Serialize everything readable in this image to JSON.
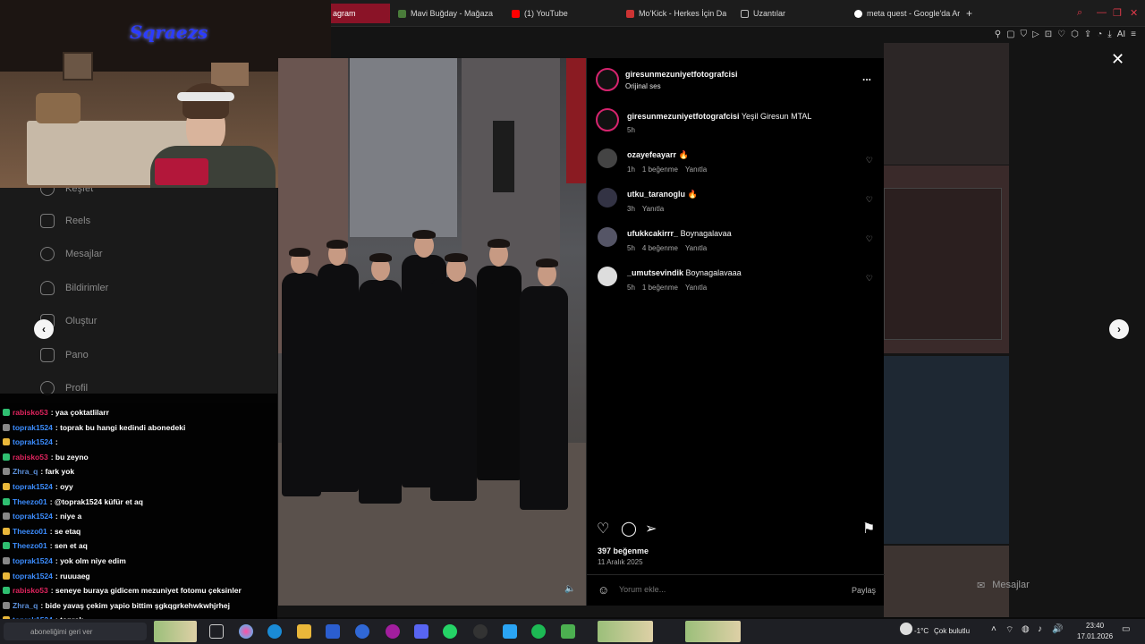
{
  "browser": {
    "tabs": [
      {
        "label": "agram",
        "active": true
      },
      {
        "label": "Mavi Buğday - Mağaza",
        "active": false
      },
      {
        "label": "(1) YouTube",
        "active": false
      },
      {
        "label": "Mo'Kick - Herkes İçin Dah",
        "active": false
      },
      {
        "label": "Uzantılar",
        "active": false
      },
      {
        "label": "meta quest - Google'da Ar",
        "active": false
      }
    ],
    "new_tab": "+",
    "toolbar_ai": "AI"
  },
  "webcam": {
    "logo_text": "Sqraezs"
  },
  "sidebar": {
    "items": [
      {
        "label": "Keşfet",
        "icon": "compass-icon"
      },
      {
        "label": "Reels",
        "icon": "reels-icon"
      },
      {
        "label": "Mesajlar",
        "icon": "messenger-icon"
      },
      {
        "label": "Bildirimler",
        "icon": "heart-icon"
      },
      {
        "label": "Oluştur",
        "icon": "plus-icon"
      },
      {
        "label": "Pano",
        "icon": "dashboard-icon"
      },
      {
        "label": "Profil",
        "icon": "profile-icon"
      }
    ]
  },
  "post": {
    "author": "giresunmezuniyetfotografcisi",
    "audio": "Orijinal ses",
    "caption_user": "giresunmezuniyetfotografcisi",
    "caption_text": "Yeşil Giresun MTAL",
    "caption_time": "5h",
    "comments": [
      {
        "user": "ozayefeayarr",
        "text": "🔥",
        "time": "1h",
        "likes": "1 beğenme",
        "reply": "Yanıtla"
      },
      {
        "user": "utku_taranoglu",
        "text": "🔥",
        "time": "3h",
        "likes": "",
        "reply": "Yanıtla"
      },
      {
        "user": "ufukkcakirrr_",
        "text": "Boynagalavaa",
        "time": "5h",
        "likes": "4 beğenme",
        "reply": "Yanıtla"
      },
      {
        "user": "_umutsevindik",
        "text": "Boynagalavaaa",
        "time": "5h",
        "likes": "1 beğenme",
        "reply": "Yanıtla"
      }
    ],
    "likes_count": "397 beğenme",
    "date": "11 Aralık 2025",
    "comment_placeholder": "Yorum ekle...",
    "share_label": "Paylaş",
    "more_label": "..."
  },
  "messages_float": {
    "label": "Mesajlar"
  },
  "chat": [
    {
      "user": "rabisko53",
      "msg": ": yaa çoktatlilarr",
      "color": "#e0245e"
    },
    {
      "user": "toprak1524",
      "msg": ": toprak bu hangi kedindi abonedeki",
      "color": "#3c8dff"
    },
    {
      "user": "toprak1524",
      "msg": ":",
      "color": "#3c8dff"
    },
    {
      "user": "rabisko53",
      "msg": ": bu zeyno",
      "color": "#e0245e"
    },
    {
      "user": "Zhra_q",
      "msg": ": fark yok",
      "color": "#5b8fd9"
    },
    {
      "user": "toprak1524",
      "msg": ": oyy",
      "color": "#3c8dff"
    },
    {
      "user": "Theezo01",
      "msg": ": @toprak1524 küfür et aq",
      "color": "#3c8dff"
    },
    {
      "user": "toprak1524",
      "msg": ": niye a",
      "color": "#3c8dff"
    },
    {
      "user": "Theezo01",
      "msg": ": se etaq",
      "color": "#3c8dff"
    },
    {
      "user": "Theezo01",
      "msg": ": sen et aq",
      "color": "#3c8dff"
    },
    {
      "user": "toprak1524",
      "msg": ": yok olm niye edim",
      "color": "#3c8dff"
    },
    {
      "user": "toprak1524",
      "msg": ": ruuuaeg",
      "color": "#3c8dff"
    },
    {
      "user": "rabisko53",
      "msg": ": seneye buraya gidicem mezuniyet fotomu çeksinler",
      "color": "#e0245e"
    },
    {
      "user": "Zhra_q",
      "msg": ": bide yavaş çekim yapio bittim şgkqgrkehwkwhjrhej",
      "color": "#5b8fd9"
    },
    {
      "user": "toprak1524",
      "msg": ": toprak",
      "color": "#3c8dff"
    }
  ],
  "chat_footer": "aboneliğimi geri ver",
  "tray": {
    "temp": "-1°C",
    "weather": "Çok bulutlu",
    "time": "23:40",
    "date": "17.01.2026"
  }
}
